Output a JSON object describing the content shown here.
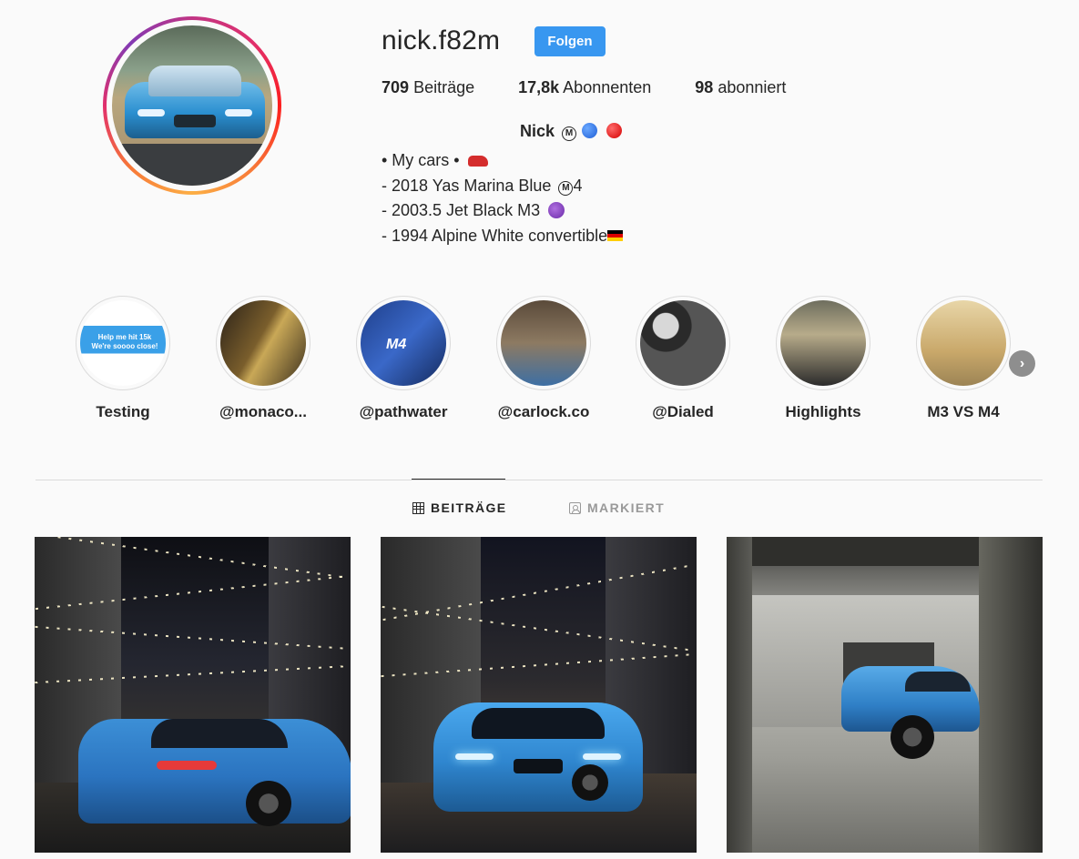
{
  "profile": {
    "username": "nick.f82m",
    "follow_label": "Folgen",
    "stats": {
      "posts_count": "709",
      "posts_label": "Beiträge",
      "followers_count": "17,8k",
      "followers_label": "Abonnenten",
      "following_count": "98",
      "following_label": "abonniert"
    },
    "display_name": "Nick",
    "badge_letter": "M",
    "bio": {
      "line1": "• My cars •",
      "line2_prefix": "- 2018 Yas Marina Blue ",
      "line2_badge": "M",
      "line2_suffix": "4",
      "line3": "- 2003.5 Jet Black M3",
      "line4": "- 1994 Alpine White convertible"
    }
  },
  "highlights": {
    "items": [
      {
        "label": "Testing",
        "overlay_text": "Help me hit 15k We're soooo close!"
      },
      {
        "label": "@monaco..."
      },
      {
        "label": "@pathwater",
        "overlay_text": "M4"
      },
      {
        "label": "@carlock.co"
      },
      {
        "label": "@Dialed"
      },
      {
        "label": "Highlights"
      },
      {
        "label": "M3 VS M4"
      }
    ],
    "next_icon": "chevron-right-icon"
  },
  "tabs": {
    "posts_label": "BEITRÄGE",
    "tagged_label": "MARKIERT",
    "active": "posts"
  },
  "colors": {
    "accent": "#3897f0",
    "text": "#262626",
    "muted": "#999999",
    "background": "#fafafa"
  }
}
